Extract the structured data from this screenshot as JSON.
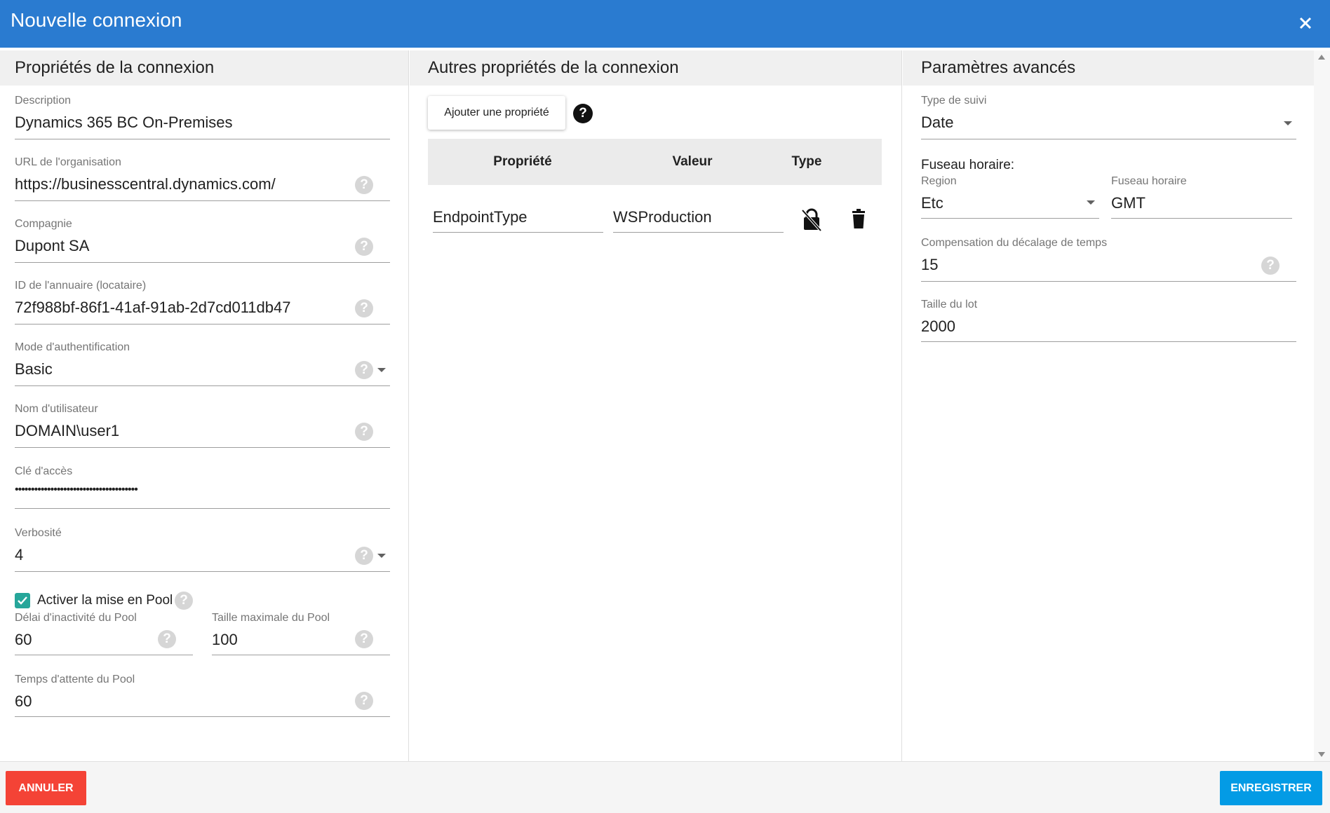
{
  "dialog": {
    "title": "Nouvelle connexion",
    "close_icon": "close-icon"
  },
  "col1": {
    "heading": "Propriétés de la connexion",
    "description": {
      "label": "Description",
      "value": "Dynamics 365 BC On-Premises"
    },
    "org_url": {
      "label": "URL de l'organisation",
      "value": "https://businesscentral.dynamics.com/"
    },
    "company": {
      "label": "Compagnie",
      "value": "Dupont SA"
    },
    "tenant_id": {
      "label": "ID de l'annuaire (locataire)",
      "value": "72f988bf-86f1-41af-91ab-2d7cd011db47"
    },
    "auth_mode": {
      "label": "Mode d'authentification",
      "value": "Basic"
    },
    "username": {
      "label": "Nom d'utilisateur",
      "value": "DOMAIN\\user1"
    },
    "access_key": {
      "label": "Clé d'accès",
      "value": "••••••••••••••••••••••••••••••••••••••"
    },
    "verbosity": {
      "label": "Verbosité",
      "value": "4"
    },
    "pool_enable": {
      "label": "Activer la mise en Pool",
      "checked": true
    },
    "pool_idle": {
      "label": "Délai d'inactivité du Pool",
      "value": "60"
    },
    "pool_max": {
      "label": "Taille maximale du Pool",
      "value": "100"
    },
    "pool_wait": {
      "label": "Temps d'attente du Pool",
      "value": "60"
    },
    "help_glyph": "?"
  },
  "col2": {
    "heading": "Autres propriétés de la connexion",
    "add_button": "Ajouter une propriété",
    "help_glyph": "?",
    "columns": [
      "Propriété",
      "Valeur",
      "Type"
    ],
    "rows": [
      {
        "property": "EndpointType",
        "value": "WSProduction",
        "type_icon": "lock-off-icon",
        "delete_icon": "trash-icon"
      }
    ]
  },
  "col3": {
    "heading": "Paramètres avancés",
    "tracking_type": {
      "label": "Type de suivi",
      "value": "Date"
    },
    "timezone_title": "Fuseau horaire:",
    "region": {
      "label": "Region",
      "value": "Etc"
    },
    "timezone": {
      "label": "Fuseau horaire",
      "value": "GMT"
    },
    "time_offset": {
      "label": "Compensation du décalage de temps",
      "value": "15"
    },
    "batch_size": {
      "label": "Taille du lot",
      "value": "2000"
    },
    "help_glyph": "?"
  },
  "footer": {
    "cancel": "ANNULER",
    "save": "ENREGISTRER"
  },
  "colors": {
    "header": "#2a7bd0",
    "cancel": "#f44336",
    "save": "#039be5",
    "checkbox": "#26a69a"
  }
}
